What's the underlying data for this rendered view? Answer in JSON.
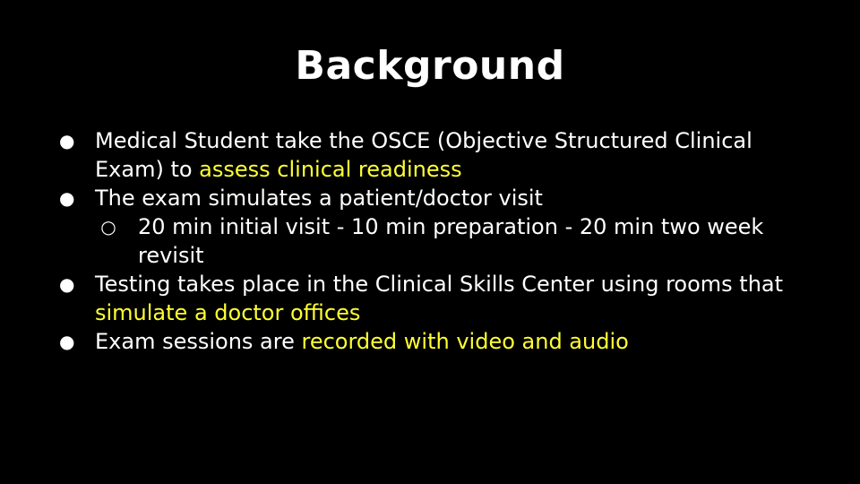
{
  "slide": {
    "title": "Background",
    "highlight_color": "#ffff33",
    "text_color": "#ffffff",
    "background_color": "#000000",
    "bullet_icon": "filled-circle-bullet-icon",
    "sub_bullet_icon": "hollow-circle-bullet-icon",
    "bullets": [
      {
        "marker": "●",
        "text": "Medical Student take the OSCE (Objective Structured Clinical Exam) to ",
        "highlight": "assess clinical readiness"
      },
      {
        "marker": "●",
        "text": "The exam simulates a patient/doctor visit",
        "sub": [
          {
            "marker": "○",
            "text": "20 min initial visit - 10 min preparation - 20 min two week revisit"
          }
        ]
      },
      {
        "marker": "●",
        "text": "Testing takes place in the Clinical Skills Center using rooms that ",
        "highlight": "simulate a doctor offices"
      },
      {
        "marker": "●",
        "text": "Exam sessions are ",
        "highlight": "recorded with video and audio"
      }
    ]
  }
}
